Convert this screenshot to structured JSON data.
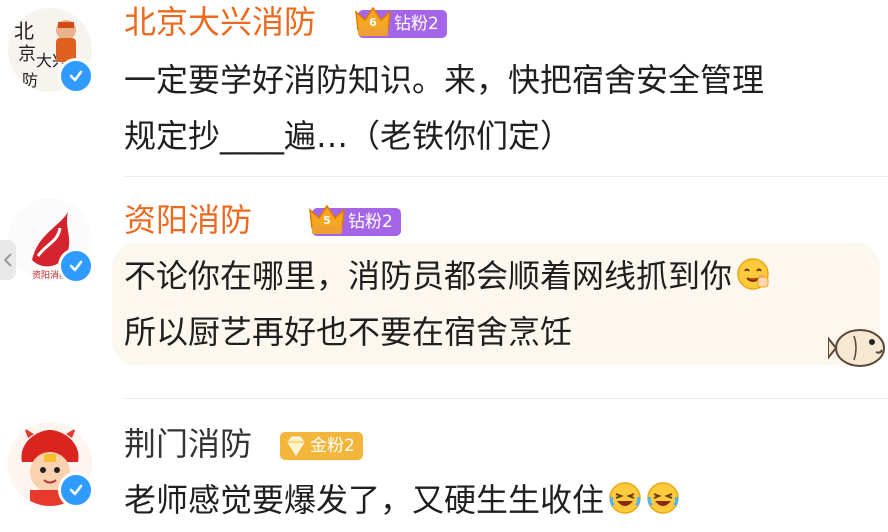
{
  "comments": [
    {
      "username": "北京大兴消防",
      "badge": "钻粉2",
      "line1": "一定要学好消防知识。来，快把宿舍安全管理",
      "line2": "规定抄____遍…（老铁你们定）"
    },
    {
      "username": "资阳消防",
      "badge": "钻粉2",
      "line1": "不论你在哪里，消防员都会顺着网线抓到你",
      "line2": "所以厨艺再好也不要在宿舍烹饪"
    },
    {
      "username": "荆门消防",
      "badge": "金粉2",
      "line1": "老师感觉要爆发了，又硬生生收住"
    }
  ],
  "colors": {
    "username_orange": "#ec6a1f",
    "username_gray": "#333333",
    "badge_purple": "#a565e8",
    "badge_gold": "#f4b63a",
    "verified_blue": "#2f9bff"
  },
  "icons": {
    "verified": "verified-check-icon",
    "crown": "crown-icon",
    "emoji_yum": "yum-emoji-icon",
    "emoji_laugh": "laugh-cry-emoji-icon",
    "fish": "fish-sticker-icon"
  }
}
